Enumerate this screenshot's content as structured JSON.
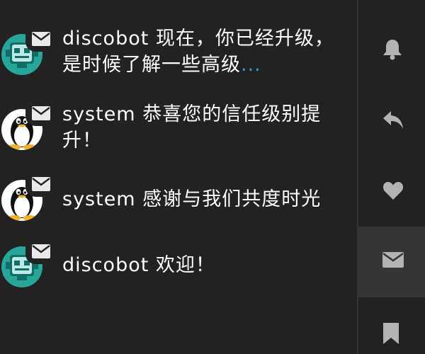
{
  "notifications": [
    {
      "username": "discobot",
      "message": "现在，你已经升级，是时候了解一些高级",
      "ellipsis": "...",
      "avatar": "robot-avatar",
      "type_icon": "envelope-icon"
    },
    {
      "username": "system",
      "message": "恭喜您的信任级别提升！",
      "ellipsis": "",
      "avatar": "tux-penguin-avatar",
      "type_icon": "envelope-icon"
    },
    {
      "username": "system",
      "message": "感谢与我们共度时光",
      "ellipsis": "",
      "avatar": "tux-penguin-avatar",
      "type_icon": "envelope-icon"
    },
    {
      "username": "discobot",
      "message": "欢迎！",
      "ellipsis": "",
      "avatar": "robot-avatar",
      "type_icon": "envelope-icon"
    }
  ],
  "sidebar_tabs": [
    {
      "icon": "bell-icon",
      "active": false
    },
    {
      "icon": "reply-icon",
      "active": false
    },
    {
      "icon": "heart-icon",
      "active": false
    },
    {
      "icon": "envelope-icon",
      "active": true
    },
    {
      "icon": "bookmark-icon",
      "active": false
    }
  ],
  "colors": {
    "background": "#222222",
    "active_tab": "#353535",
    "text": "#ffffff",
    "icon": "#b3b3b3",
    "link": "#2b9fd8",
    "robot_teal": "#27a69a"
  }
}
